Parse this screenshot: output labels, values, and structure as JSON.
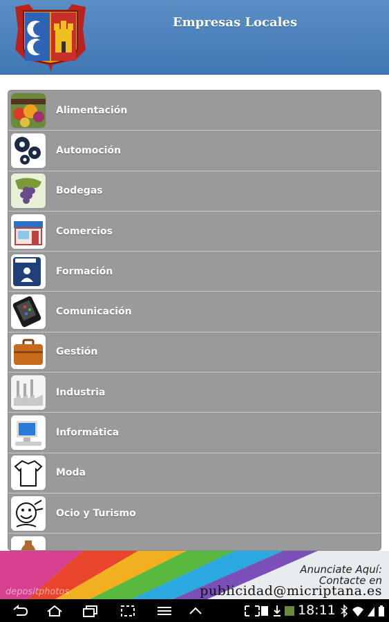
{
  "header": {
    "title": "Empresas Locales"
  },
  "categories": [
    {
      "label": "Alimentación",
      "icon": "food-icon"
    },
    {
      "label": "Automoción",
      "icon": "gears-icon"
    },
    {
      "label": "Bodegas",
      "icon": "grapes-icon"
    },
    {
      "label": "Comercios",
      "icon": "storefront-icon"
    },
    {
      "label": "Formación",
      "icon": "training-icon"
    },
    {
      "label": "Comunicación",
      "icon": "phone-icon"
    },
    {
      "label": "Gestión",
      "icon": "briefcase-icon"
    },
    {
      "label": "Industria",
      "icon": "factory-icon"
    },
    {
      "label": "Informática",
      "icon": "computer-icon"
    },
    {
      "label": "Moda",
      "icon": "shirt-icon"
    },
    {
      "label": "Ocio y Turismo",
      "icon": "leisure-icon"
    },
    {
      "label": "",
      "icon": "jug-icon"
    }
  ],
  "ad": {
    "line1": "Anunciate Aquí:",
    "line2": "Contacte en",
    "line3": "publicidad@micriptana.es",
    "watermark": "depositphotos"
  },
  "status": {
    "time": "18:11"
  },
  "colors": {
    "header": "#4a82bd",
    "list_bg": "#9a9a9a",
    "label": "#ffffff"
  }
}
